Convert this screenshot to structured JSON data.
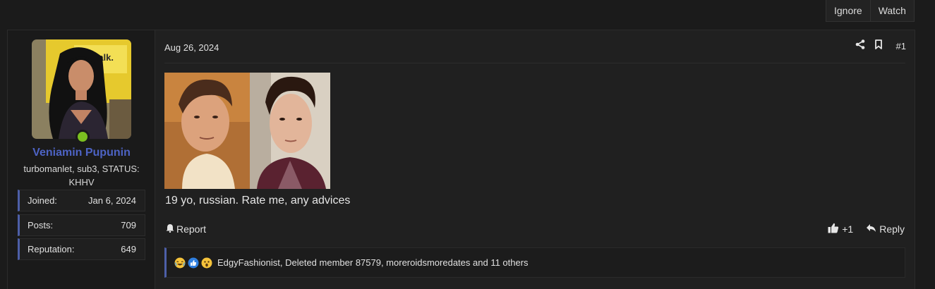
{
  "thread_actions": {
    "ignore_label": "Ignore",
    "watch_label": "Watch"
  },
  "user": {
    "name": "Veniamin Pupunin",
    "title": "turbomanlet, sub3, STATUS: KHHV",
    "stats": [
      {
        "label": "Joined:",
        "value": "Jan 6, 2024"
      },
      {
        "label": "Posts:",
        "value": "709"
      },
      {
        "label": "Reputation:",
        "value": "649"
      }
    ],
    "online_color": "#7bbf20",
    "avatar_sign_text": "talk."
  },
  "post": {
    "date": "Aug 26, 2024",
    "number": "#1",
    "text": "19 yo, russian. Rate me, any advices",
    "report_label": "Report",
    "like_label": "+1",
    "reply_label": "Reply",
    "reactions_text": "EdgyFashionist, Deleted member 87579, moreroidsmoredates and 11 others",
    "reaction_icons": [
      "laughing-emoji-icon",
      "like-emoji-icon",
      "shocked-emoji-icon"
    ]
  },
  "colors": {
    "accent": "#4d5fa8",
    "username": "#4d63c4"
  }
}
